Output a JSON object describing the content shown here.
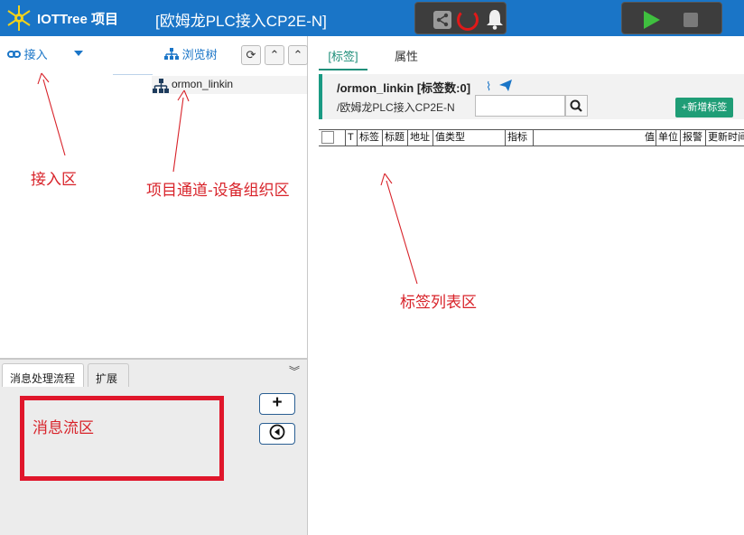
{
  "topbar": {
    "app_title": "IOTTree 项目",
    "project_title": "[欧姆龙PLC接入CP2E-N]",
    "icons": {
      "logo": "iottree-logo-icon",
      "share": "share-icon",
      "status": "status-ring-icon",
      "alarm": "bell-icon",
      "start": "play-icon",
      "stop": "stop-icon"
    },
    "colors": {
      "bar": "#1a75c7",
      "run": "#3fbf3f",
      "status_ring": "#e01919"
    }
  },
  "left": {
    "access_label": "接入",
    "browse_label": "浏览树",
    "tree": {
      "node_label": "ormon_linkin"
    },
    "bottom_tabs": [
      "消息处理流程",
      "扩展"
    ],
    "buttons": {
      "add": "+",
      "back": "⊖"
    }
  },
  "right": {
    "tabs": [
      "[标签]",
      "属性"
    ],
    "tag_path": "/ormon_linkin [标签数:0]",
    "sub_path": "/欧姆龙PLC接入CP2E-N",
    "add_tag_label": "+新增标签",
    "columns": [
      "T",
      "标签",
      "标题",
      "地址",
      "值类型",
      "指标",
      "值",
      "单位",
      "报警",
      "更新时间"
    ],
    "accent": "#1f9d76"
  },
  "annotations": {
    "access_area": "接入区",
    "project_channel": "项目通道-设备组织区",
    "tag_list": "标签列表区",
    "message_flow": "消息流区",
    "color": "#d8232a"
  }
}
